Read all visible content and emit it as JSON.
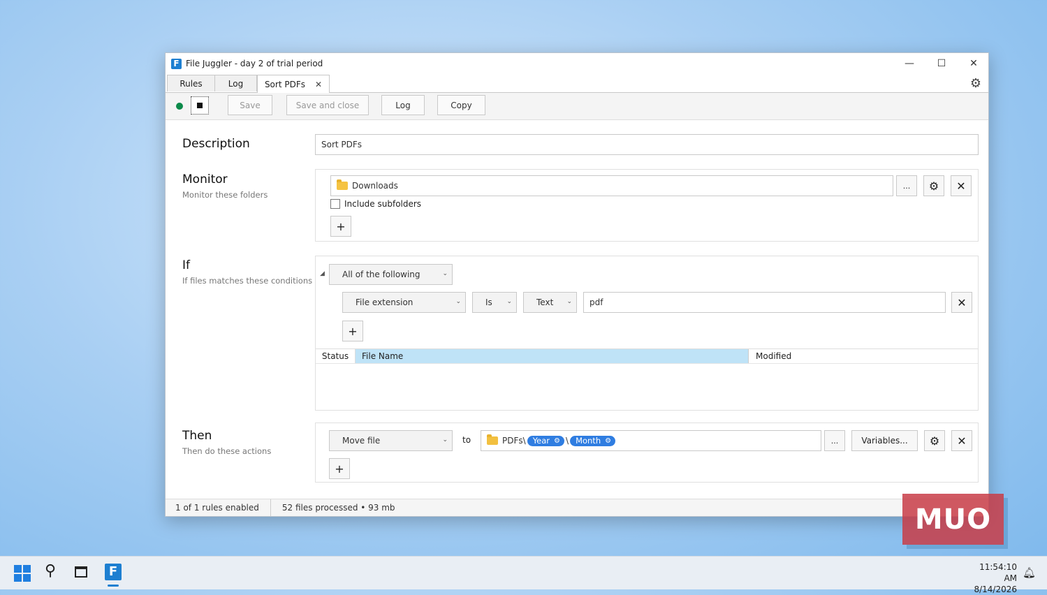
{
  "window": {
    "title": "File Juggler - day 2 of trial period",
    "logo_letter": "F",
    "minimize": "—",
    "maximize": "☐",
    "close": "✕"
  },
  "tabs": [
    {
      "label": "Rules"
    },
    {
      "label": "Log"
    },
    {
      "label": "Sort PDFs",
      "active": true,
      "close": "✕"
    }
  ],
  "toolbar": {
    "save": "Save",
    "save_close": "Save and close",
    "log": "Log",
    "copy": "Copy"
  },
  "description": {
    "title": "Description",
    "value": "Sort PDFs"
  },
  "monitor": {
    "title": "Monitor",
    "subtitle": "Monitor these folders",
    "folder": "Downloads",
    "browse": "...",
    "include_subfolders": "Include subfolders",
    "include_checked": false
  },
  "if": {
    "title": "If",
    "subtitle": "If files matches these conditions",
    "group": "All of the following",
    "condition": {
      "field": "File extension",
      "operator": "Is",
      "type": "Text",
      "value": "pdf"
    },
    "table_headers": {
      "status": "Status",
      "file_name": "File Name",
      "modified": "Modified"
    }
  },
  "then": {
    "title": "Then",
    "subtitle": "Then do these actions",
    "action": "Move file",
    "to": "to",
    "path_prefix": "PDFs\\",
    "separator": "\\",
    "chip1": "Year",
    "chip2": "Month",
    "browse": "...",
    "variables": "Variables..."
  },
  "statusbar": {
    "rules": "1 of 1 rules enabled",
    "processed": "52 files processed • 93 mb"
  },
  "taskbar": {
    "time": "11:54:10 AM",
    "date": "8/14/2026"
  },
  "watermark": "MUO",
  "colors": {
    "accent": "#2f7de1",
    "header_highlight": "#bfe3f7",
    "status_green": "#0b8a4a"
  }
}
